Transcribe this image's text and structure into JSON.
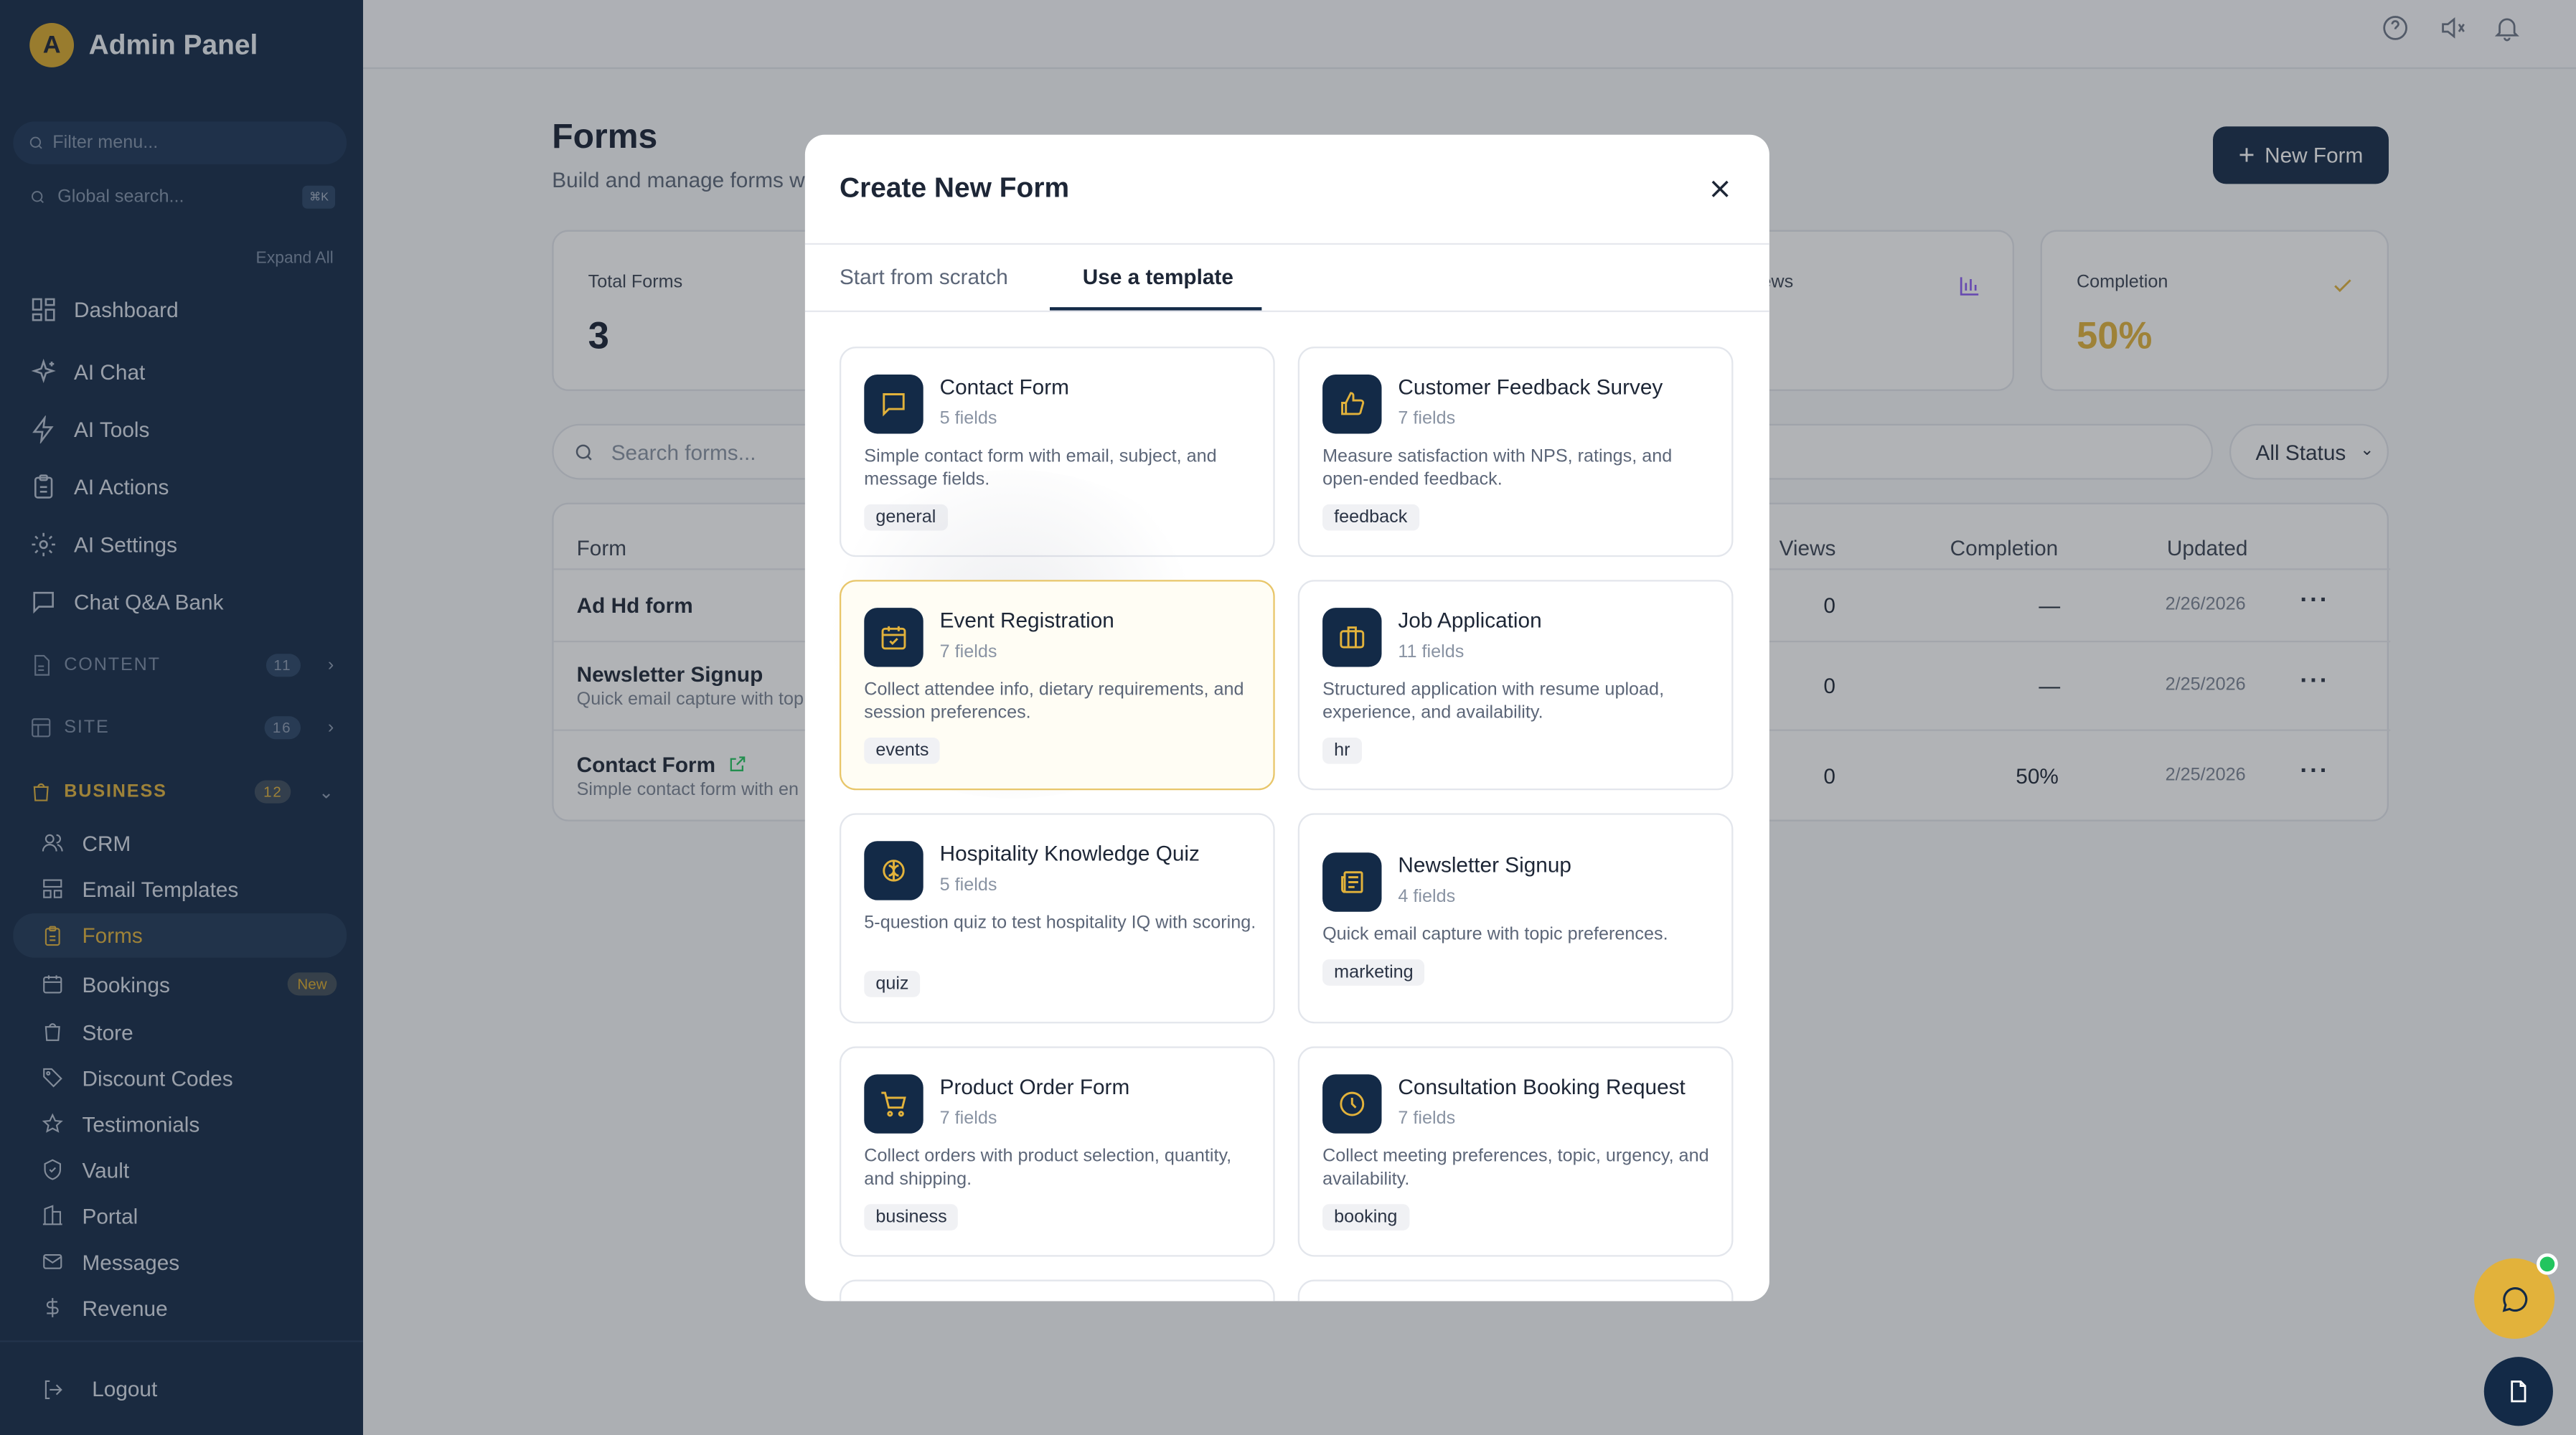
{
  "sidebar": {
    "brand_letter": "A",
    "brand_name": "Admin Panel",
    "filter_placeholder": "Filter menu...",
    "global_search": "Global search...",
    "global_kbd": "⌘K",
    "expand_all": "Expand All",
    "top_items": [
      {
        "label": "Dashboard",
        "icon": "grid-icon"
      },
      {
        "label": "AI Chat",
        "icon": "sparkle-icon"
      },
      {
        "label": "AI Tools",
        "icon": "bolt-icon"
      },
      {
        "label": "AI Actions",
        "icon": "clipboard-icon"
      },
      {
        "label": "AI Settings",
        "icon": "gear-icon"
      },
      {
        "label": "Chat Q&A Bank",
        "icon": "message-icon"
      }
    ],
    "sections": [
      {
        "label": "CONTENT",
        "count": "11"
      },
      {
        "label": "SITE",
        "count": "16"
      },
      {
        "label": "BUSINESS",
        "count": "12"
      }
    ],
    "business_items": [
      {
        "label": "CRM"
      },
      {
        "label": "Email Templates"
      },
      {
        "label": "Forms"
      },
      {
        "label": "Bookings",
        "badge": "New"
      },
      {
        "label": "Store"
      },
      {
        "label": "Discount Codes"
      },
      {
        "label": "Testimonials"
      },
      {
        "label": "Vault"
      },
      {
        "label": "Portal"
      },
      {
        "label": "Messages"
      },
      {
        "label": "Revenue"
      }
    ],
    "logout": "Logout"
  },
  "page": {
    "title": "Forms",
    "subtitle": "Build and manage forms w",
    "new_form_label": "New Form",
    "stats": [
      {
        "label": "Total Forms",
        "value": "3"
      },
      {
        "label": "ews",
        "value": ""
      },
      {
        "label": "Completion",
        "value": "50%"
      }
    ],
    "search_placeholder": "Search forms...",
    "status_filter": "All Status",
    "table": {
      "headers": [
        "Form",
        "Views",
        "Completion",
        "Updated"
      ],
      "rows": [
        {
          "name": "Ad Hd form",
          "desc": "",
          "views": "0",
          "completion": "—",
          "updated": "2/26/2026"
        },
        {
          "name": "Newsletter Signup",
          "desc": "Quick email capture with top",
          "views": "0",
          "completion": "—",
          "updated": "2/25/2026"
        },
        {
          "name": "Contact Form",
          "desc": "Simple contact form with en",
          "views": "0",
          "completion": "50%",
          "updated": "2/25/2026"
        }
      ]
    }
  },
  "modal": {
    "title": "Create New Form",
    "tabs": [
      "Start from scratch",
      "Use a template"
    ],
    "active_tab": "Use a template",
    "templates": [
      {
        "title": "Contact Form",
        "fields": "5 fields",
        "desc": "Simple contact form with email, subject, and message fields.",
        "tag": "general",
        "icon": "message-icon"
      },
      {
        "title": "Customer Feedback Survey",
        "fields": "7 fields",
        "desc": "Measure satisfaction with NPS, ratings, and open-ended feedback.",
        "tag": "feedback",
        "icon": "thumbs-up-icon"
      },
      {
        "title": "Event Registration",
        "fields": "7 fields",
        "desc": "Collect attendee info, dietary requirements, and session preferences.",
        "tag": "events",
        "icon": "calendar-check-icon"
      },
      {
        "title": "Job Application",
        "fields": "11 fields",
        "desc": "Structured application with resume upload, experience, and availability.",
        "tag": "hr",
        "icon": "briefcase-icon"
      },
      {
        "title": "Hospitality Knowledge Quiz",
        "fields": "5 fields",
        "desc": "5-question quiz to test hospitality IQ with scoring.",
        "tag": "quiz",
        "icon": "brain-icon"
      },
      {
        "title": "Newsletter Signup",
        "fields": "4 fields",
        "desc": "Quick email capture with topic preferences.",
        "tag": "marketing",
        "icon": "newspaper-icon"
      },
      {
        "title": "Product Order Form",
        "fields": "7 fields",
        "desc": "Collect orders with product selection, quantity, and shipping.",
        "tag": "business",
        "icon": "cart-icon"
      },
      {
        "title": "Consultation Booking Request",
        "fields": "7 fields",
        "desc": "Collect meeting preferences, topic, urgency, and availability.",
        "tag": "booking",
        "icon": "clock-icon"
      }
    ]
  },
  "colors": {
    "sidebar_bg": "#132a47",
    "accent": "#e2b23b",
    "primary": "#132a47",
    "online": "#22c55e"
  }
}
